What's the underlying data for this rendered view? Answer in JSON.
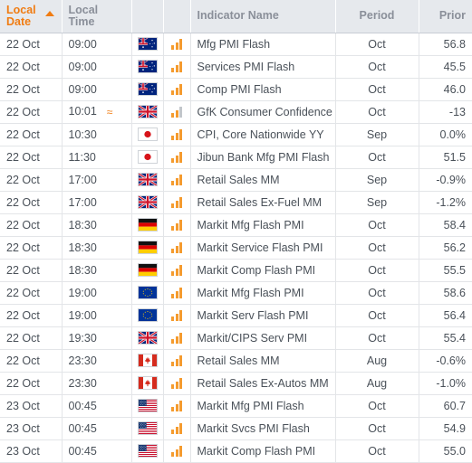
{
  "table": {
    "columns": [
      {
        "key": "date",
        "label": "Local Date",
        "sorted": true,
        "sort_dir": "asc"
      },
      {
        "key": "time",
        "label": "Local Time"
      },
      {
        "key": "flag",
        "label": ""
      },
      {
        "key": "vol",
        "label": ""
      },
      {
        "key": "name",
        "label": "Indicator Name"
      },
      {
        "key": "period",
        "label": "Period"
      },
      {
        "key": "prior",
        "label": "Prior"
      }
    ],
    "header": {
      "date_line1": "Local",
      "date_line2": "Date",
      "time_line1": "Local",
      "time_line2": "Time",
      "indicator": "Indicator Name",
      "period": "Period",
      "prior": "Prior"
    },
    "rows": [
      {
        "date": "22 Oct",
        "time": "09:00",
        "approx": "",
        "country": "AU",
        "volatility": 3,
        "name": "Mfg PMI Flash",
        "period": "Oct",
        "prior": "56.8"
      },
      {
        "date": "22 Oct",
        "time": "09:00",
        "approx": "",
        "country": "AU",
        "volatility": 3,
        "name": "Services PMI Flash",
        "period": "Oct",
        "prior": "45.5"
      },
      {
        "date": "22 Oct",
        "time": "09:00",
        "approx": "",
        "country": "AU",
        "volatility": 3,
        "name": "Comp PMI Flash",
        "period": "Oct",
        "prior": "46.0"
      },
      {
        "date": "22 Oct",
        "time": "10:01",
        "approx": "≈",
        "country": "GB",
        "volatility": 2,
        "name": "GfK Consumer Confidence",
        "period": "Oct",
        "prior": "-13"
      },
      {
        "date": "22 Oct",
        "time": "10:30",
        "approx": "",
        "country": "JP",
        "volatility": 3,
        "name": "CPI, Core Nationwide YY",
        "period": "Sep",
        "prior": "0.0%"
      },
      {
        "date": "22 Oct",
        "time": "11:30",
        "approx": "",
        "country": "JP",
        "volatility": 3,
        "name": "Jibun Bank Mfg PMI Flash",
        "period": "Oct",
        "prior": "51.5"
      },
      {
        "date": "22 Oct",
        "time": "17:00",
        "approx": "",
        "country": "GB",
        "volatility": 3,
        "name": "Retail Sales MM",
        "period": "Sep",
        "prior": "-0.9%"
      },
      {
        "date": "22 Oct",
        "time": "17:00",
        "approx": "",
        "country": "GB",
        "volatility": 3,
        "name": "Retail Sales Ex-Fuel MM",
        "period": "Sep",
        "prior": "-1.2%"
      },
      {
        "date": "22 Oct",
        "time": "18:30",
        "approx": "",
        "country": "DE",
        "volatility": 3,
        "name": "Markit Mfg Flash PMI",
        "period": "Oct",
        "prior": "58.4"
      },
      {
        "date": "22 Oct",
        "time": "18:30",
        "approx": "",
        "country": "DE",
        "volatility": 3,
        "name": "Markit Service Flash PMI",
        "period": "Oct",
        "prior": "56.2"
      },
      {
        "date": "22 Oct",
        "time": "18:30",
        "approx": "",
        "country": "DE",
        "volatility": 3,
        "name": "Markit Comp Flash PMI",
        "period": "Oct",
        "prior": "55.5"
      },
      {
        "date": "22 Oct",
        "time": "19:00",
        "approx": "",
        "country": "EU",
        "volatility": 3,
        "name": "Markit Mfg Flash PMI",
        "period": "Oct",
        "prior": "58.6"
      },
      {
        "date": "22 Oct",
        "time": "19:00",
        "approx": "",
        "country": "EU",
        "volatility": 3,
        "name": "Markit Serv Flash PMI",
        "period": "Oct",
        "prior": "56.4"
      },
      {
        "date": "22 Oct",
        "time": "19:30",
        "approx": "",
        "country": "GB",
        "volatility": 3,
        "name": "Markit/CIPS Serv PMI",
        "period": "Oct",
        "prior": "55.4"
      },
      {
        "date": "22 Oct",
        "time": "23:30",
        "approx": "",
        "country": "CA",
        "volatility": 3,
        "name": "Retail Sales MM",
        "period": "Aug",
        "prior": "-0.6%"
      },
      {
        "date": "22 Oct",
        "time": "23:30",
        "approx": "",
        "country": "CA",
        "volatility": 3,
        "name": "Retail Sales Ex-Autos MM",
        "period": "Aug",
        "prior": "-1.0%"
      },
      {
        "date": "23 Oct",
        "time": "00:45",
        "approx": "",
        "country": "US",
        "volatility": 3,
        "name": "Markit Mfg PMI Flash",
        "period": "Oct",
        "prior": "60.7"
      },
      {
        "date": "23 Oct",
        "time": "00:45",
        "approx": "",
        "country": "US",
        "volatility": 3,
        "name": "Markit Svcs PMI Flash",
        "period": "Oct",
        "prior": "54.9"
      },
      {
        "date": "23 Oct",
        "time": "00:45",
        "approx": "",
        "country": "US",
        "volatility": 3,
        "name": "Markit Comp Flash PMI",
        "period": "Oct",
        "prior": "55.0"
      }
    ]
  },
  "colors": {
    "accent_orange": "#f07c12",
    "volatility_bar": "#f59b2e",
    "volatility_bar_off": "#c2c6cb",
    "header_bg": "#e6e9ed",
    "header_text": "#8a8f99",
    "body_text": "#4a5159",
    "grid_line": "#e3e5e8"
  },
  "icons": {
    "sort_ascending": "sort-ascending-icon",
    "approximate_time": "approximate-time-icon",
    "volatility": "volatility-bars-icon"
  }
}
